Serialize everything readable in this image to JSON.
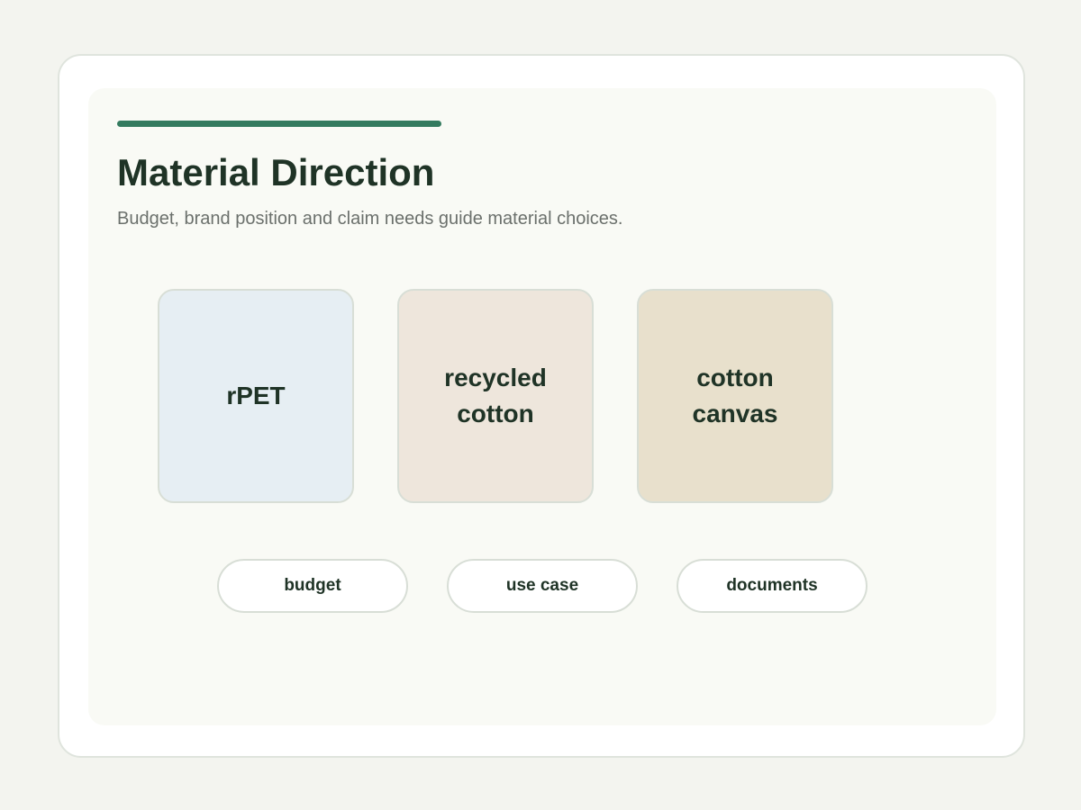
{
  "header": {
    "title": "Material Direction",
    "subtitle": "Budget, brand position and claim needs guide material choices."
  },
  "materials": [
    {
      "label": "rPET",
      "color": "#e6eef3"
    },
    {
      "label": "recycled cotton",
      "color": "#eee6dc"
    },
    {
      "label": "cotton canvas",
      "color": "#e8e0cc"
    }
  ],
  "filters": [
    {
      "label": "budget"
    },
    {
      "label": "use case"
    },
    {
      "label": "documents"
    }
  ],
  "colors": {
    "accent": "#347b5f",
    "text": "#1f3326",
    "muted": "#6b706c",
    "background": "#f3f4ef"
  }
}
